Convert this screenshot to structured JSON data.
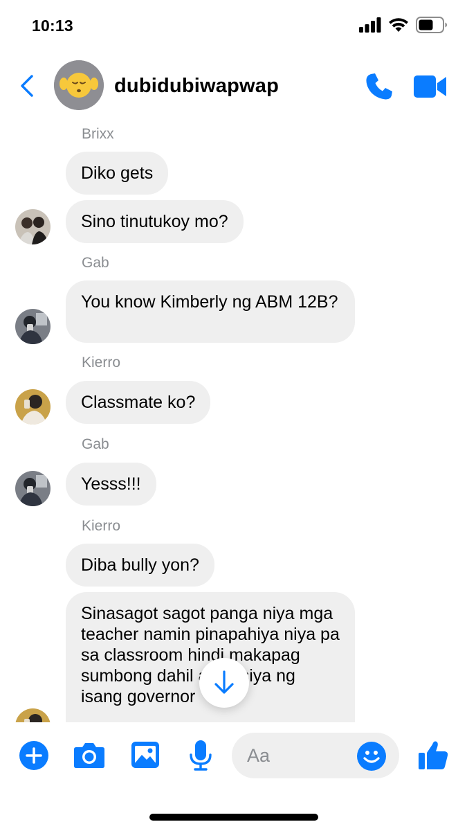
{
  "status_bar": {
    "time": "10:13"
  },
  "header": {
    "title": "dubidubiwapwap"
  },
  "messages": [
    {
      "sender": "Brixx",
      "texts": [
        "Diko gets",
        "Sino tinutukoy mo?"
      ]
    },
    {
      "sender": "Gab",
      "texts": [
        "You know Kimberly ng ABM 12B?"
      ]
    },
    {
      "sender": "Kierro",
      "texts": [
        "Classmate ko?"
      ]
    },
    {
      "sender": "Gab",
      "texts": [
        "Yesss!!!"
      ]
    },
    {
      "sender": "Kierro",
      "texts": [
        "Diba bully yon?",
        "Sinasagot sagot panga niya mga teacher namin pinapahiya niya pa sa classroom hindi makapag sumbong dahil anak siya ng isang governor"
      ]
    }
  ],
  "composer": {
    "placeholder": "Aa"
  },
  "colors": {
    "accent": "#0a7cff",
    "bubble": "#efefef",
    "meta_text": "#8a8d91"
  },
  "icons": {
    "status": [
      "signal-icon",
      "wifi-icon",
      "battery-icon"
    ],
    "header": [
      "back-chevron-icon",
      "phone-icon",
      "video-camera-icon"
    ],
    "composer": [
      "plus-icon",
      "camera-icon",
      "photo-icon",
      "microphone-icon",
      "smile-icon",
      "thumbs-up-icon"
    ],
    "scroll": "arrow-down-icon"
  }
}
